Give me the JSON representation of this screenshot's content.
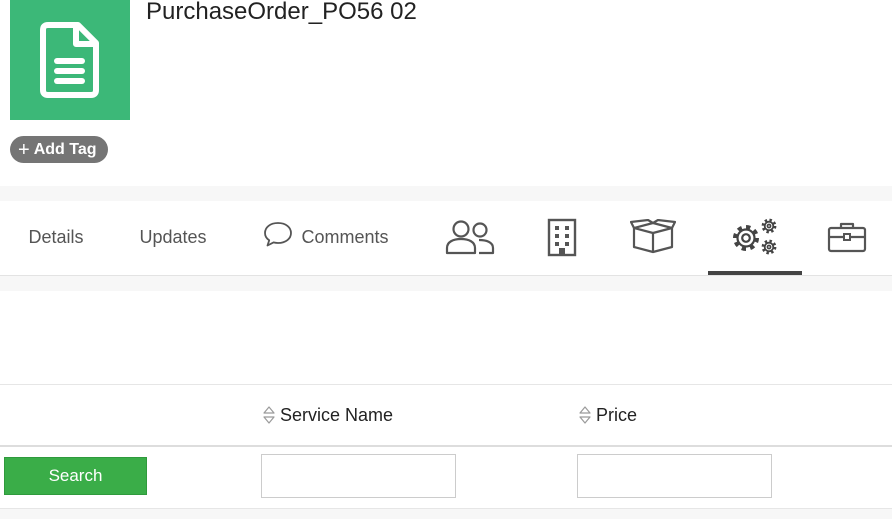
{
  "record": {
    "title": "PurchaseOrder_PO56 02",
    "icon": "document-icon",
    "icon_color": "#3cb878",
    "add_tag_label": "Add Tag"
  },
  "tabs": [
    {
      "label": "Details",
      "icon": null
    },
    {
      "label": "Updates",
      "icon": null
    },
    {
      "label": "Comments",
      "icon": "speech-bubble-icon"
    },
    {
      "label": "",
      "icon": "users-icon"
    },
    {
      "label": "",
      "icon": "building-icon"
    },
    {
      "label": "",
      "icon": "box-icon"
    },
    {
      "label": "",
      "icon": "gears-icon",
      "active": true
    },
    {
      "label": "",
      "icon": "briefcase-icon"
    }
  ],
  "grid": {
    "columns": [
      {
        "label": "Service Name",
        "sortable": true
      },
      {
        "label": "Price",
        "sortable": true
      }
    ],
    "search_button": "Search",
    "filters": [
      {
        "value": "",
        "placeholder": ""
      },
      {
        "value": "",
        "placeholder": ""
      }
    ]
  },
  "colors": {
    "search_button": "#3aad48",
    "tag_pill": "#757575",
    "active_tab_underline": "#444444"
  }
}
